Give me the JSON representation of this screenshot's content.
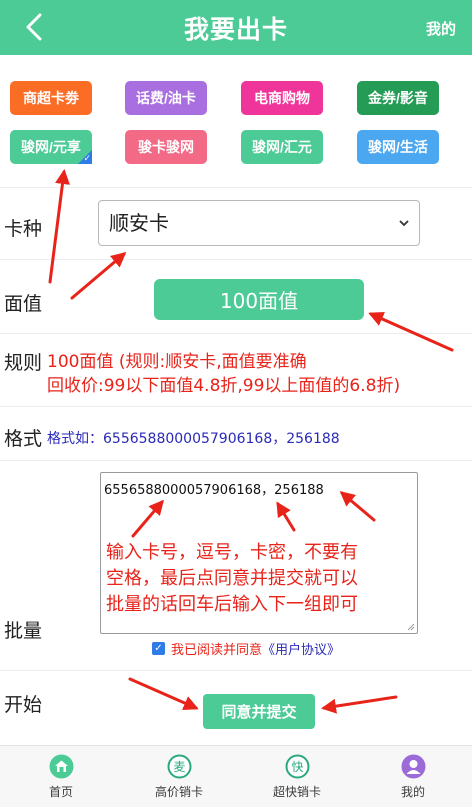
{
  "header": {
    "title": "我要出卡",
    "right_link": "我的"
  },
  "categories": [
    {
      "label": "商超卡劵",
      "color": "#fb6c25"
    },
    {
      "label": "话费/油卡",
      "color": "#a96fe0"
    },
    {
      "label": "电商购物",
      "color": "#f0359a"
    },
    {
      "label": "金券/影音",
      "color": "#249c55"
    },
    {
      "label": "骏网/元享",
      "color": "#4ccb96",
      "selected": true
    },
    {
      "label": "骏卡骏网",
      "color": "#f36a87"
    },
    {
      "label": "骏网/汇元",
      "color": "#4ccb96"
    },
    {
      "label": "骏网/生活",
      "color": "#4ba8f0"
    }
  ],
  "form": {
    "card_type_label": "卡种",
    "card_type_value": "顺安卡",
    "face_value_label": "面值",
    "face_value_button": "100面值",
    "rule_label": "规则",
    "rule_line1": "100面值    (规则:顺安卡,面值要准确",
    "rule_line2": "回收价:99以下面值4.8折,99以上面值的6.8折)",
    "format_label": "格式",
    "format_text": "格式如：6556588000057906168，256188",
    "batch_label": "批量",
    "batch_value": "6556588000057906168，256188",
    "agree_checked": true,
    "agree_text": "我已阅读并同意",
    "agreement_link": "《用户协议》",
    "start_label": "开始",
    "submit_label": "同意并提交"
  },
  "annotation": {
    "line1": "输入卡号，逗号，卡密，不要有",
    "line2": "空格，最后点同意并提交就可以",
    "line3": "批量的话回车后输入下一组即可",
    "color": "#e8231a"
  },
  "tabbar": [
    {
      "label": "首页",
      "icon": "home-icon"
    },
    {
      "label": "高价销卡",
      "icon": "sell-high-icon"
    },
    {
      "label": "超快销卡",
      "icon": "sell-fast-icon"
    },
    {
      "label": "我的",
      "icon": "user-icon"
    }
  ],
  "colors": {
    "brand": "#4ccb96",
    "accent_red": "#e8231a",
    "link_blue": "#2a2ab8"
  }
}
